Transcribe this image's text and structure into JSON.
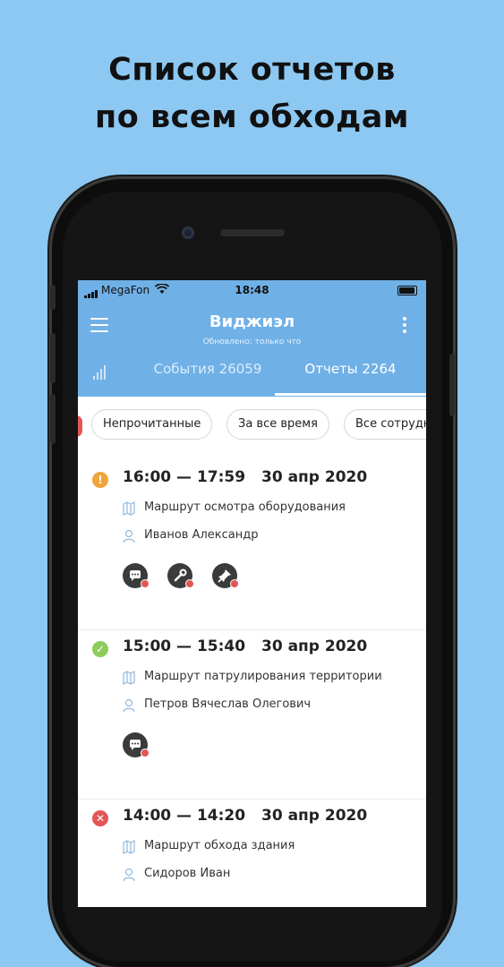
{
  "headline": {
    "line1": "Список отчетов",
    "line2": "по всем обходам"
  },
  "status_bar": {
    "carrier": "MegaFon",
    "time": "18:48"
  },
  "app": {
    "title": "Виджиэл",
    "updated": "Обновлено: только что"
  },
  "tabs": [
    {
      "label": "События 26059",
      "active": false
    },
    {
      "label": "Отчеты 2264",
      "active": true
    }
  ],
  "filters": [
    "Непрочитанные",
    "За все время",
    "Все сотрудники"
  ],
  "reports": [
    {
      "status": "warning",
      "time": "16:00 — 17:59",
      "date": "30 апр 2020",
      "route": "Маршрут осмотра оборудования",
      "person": "Иванов Александр",
      "actions": [
        "comment-icon",
        "wrench-icon",
        "pin-icon"
      ]
    },
    {
      "status": "success",
      "time": "15:00 — 15:40",
      "date": "30 апр 2020",
      "route": "Маршрут патрулирования территории",
      "person": "Петров Вячеслав Олегович",
      "actions": [
        "comment-icon"
      ]
    },
    {
      "status": "error",
      "time": "14:00 — 14:20",
      "date": "30 апр 2020",
      "route": "Маршрут обхода здания",
      "person": "Сидоров Иван",
      "actions": []
    }
  ],
  "colors": {
    "background": "#8cc8f2",
    "header": "#6fb0e6",
    "warning": "#f0a43a",
    "success": "#8ccc5c",
    "error": "#e25656",
    "badge": "#e25656"
  }
}
